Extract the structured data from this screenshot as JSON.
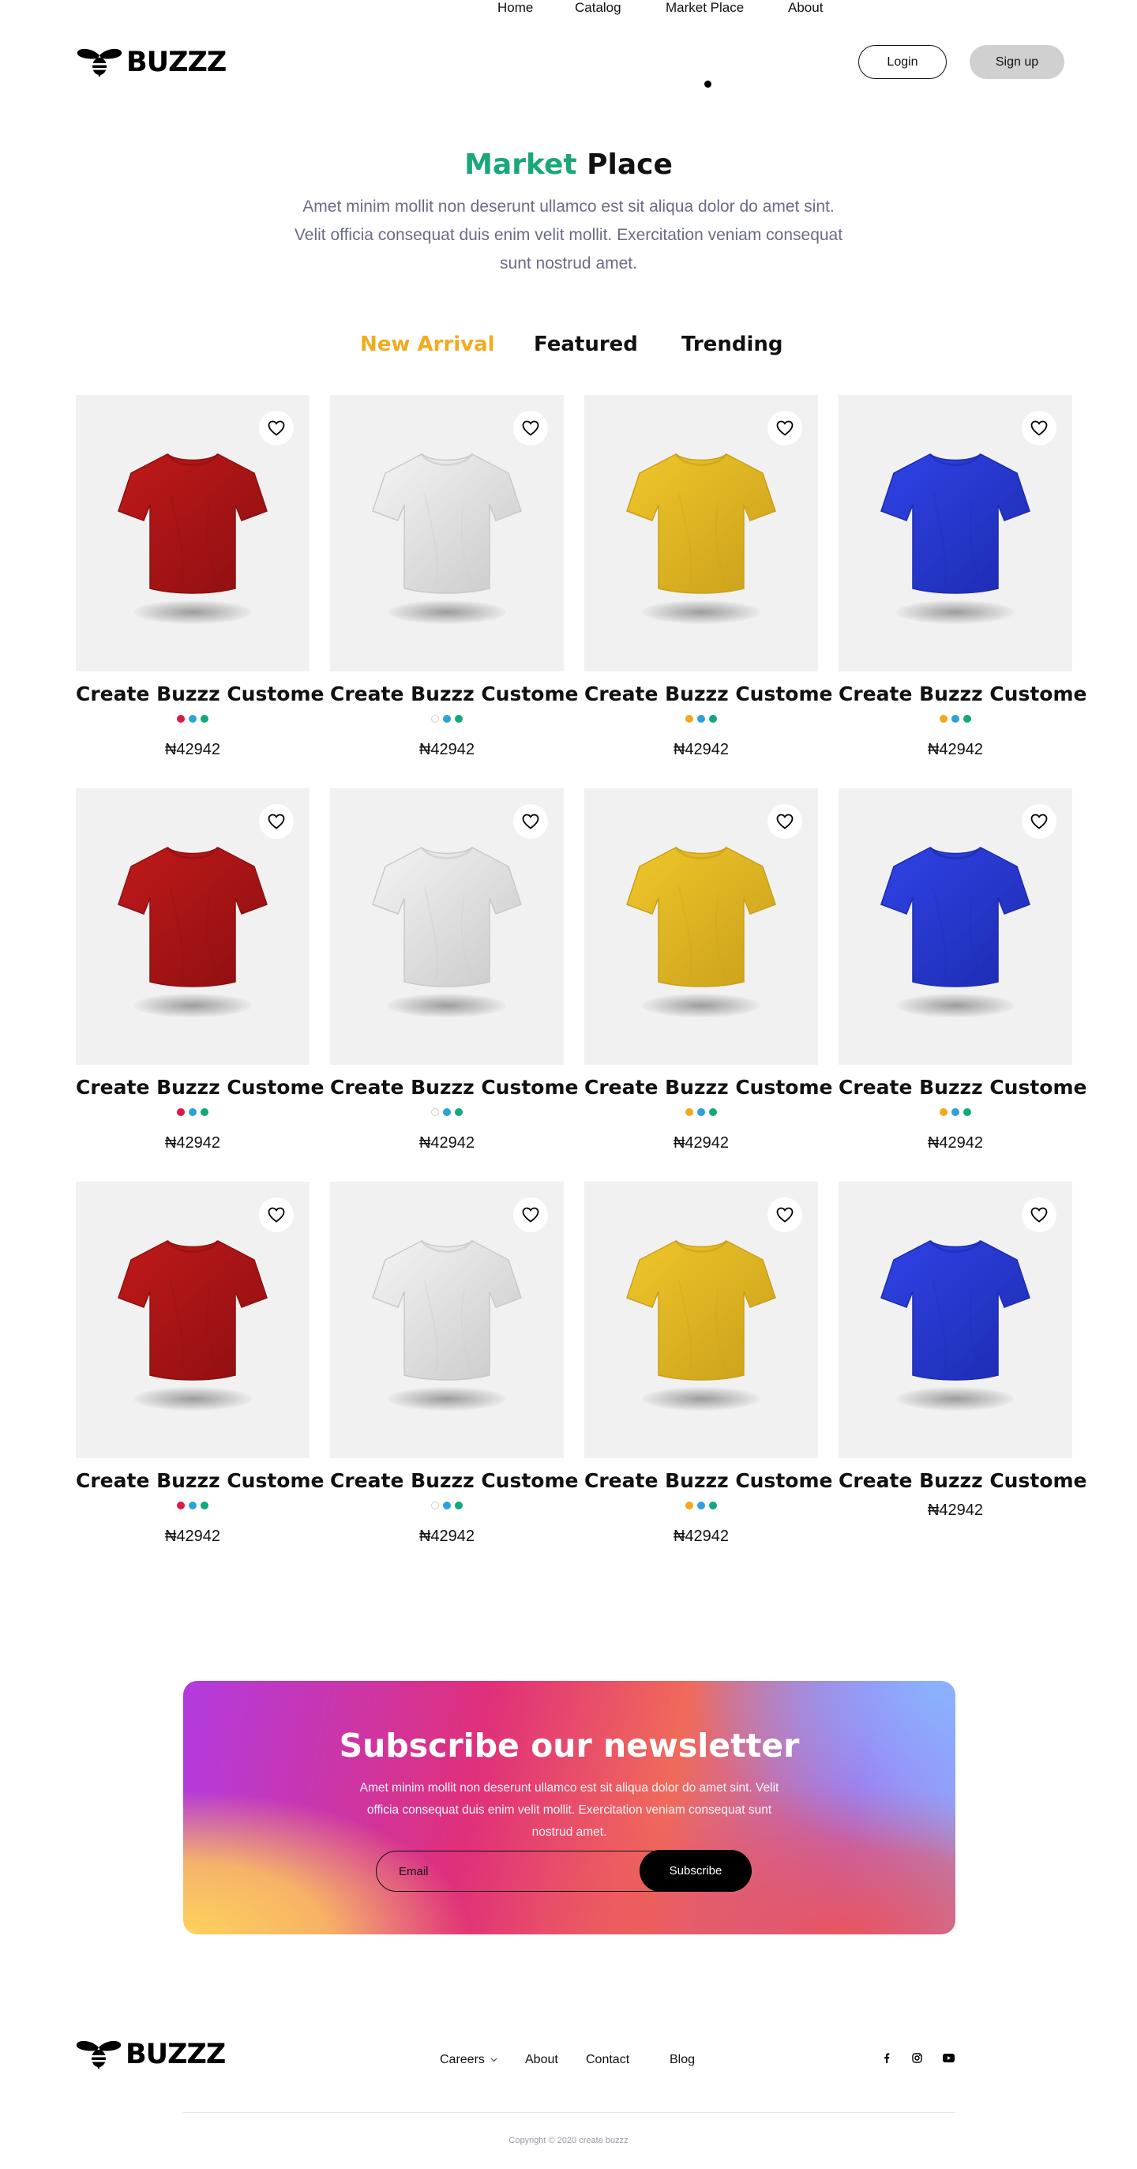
{
  "brand": {
    "name": "BUZZZ"
  },
  "nav": {
    "items": [
      {
        "label": "Home"
      },
      {
        "label": "Catalog"
      },
      {
        "label": "Market Place",
        "active": true
      },
      {
        "label": "About"
      }
    ],
    "login": "Login",
    "signup": "Sign up"
  },
  "hero": {
    "title_accent": "Market",
    "title_rest": "Place",
    "description": "Amet minim mollit non deserunt ullamco est sit aliqua dolor do amet sint. Velit officia consequat duis enim velit mollit. Exercitation veniam consequat sunt nostrud amet."
  },
  "tabs": [
    {
      "label": "New Arrival",
      "active": true
    },
    {
      "label": "Featured"
    },
    {
      "label": "Trending"
    }
  ],
  "colors": {
    "accent_green": "#1aa67a",
    "accent_orange": "#f2ab1f",
    "shirt_red": "#c0191a",
    "shirt_white": "#f4f4f4",
    "shirt_yellow": "#efc629",
    "shirt_blue": "#2f43e6"
  },
  "products": [
    {
      "title": "Create Buzzz Custome",
      "price": "₦42942",
      "shirt_color": "red",
      "swatches": [
        "#e0174b",
        "#2ea1d8",
        "#0fa97c"
      ]
    },
    {
      "title": "Create Buzzz Custome",
      "price": "₦42942",
      "shirt_color": "white",
      "swatches": [
        "#ffffff",
        "#2ea1d8",
        "#0fa97c"
      ]
    },
    {
      "title": "Create Buzzz Custome",
      "price": "₦42942",
      "shirt_color": "yellow",
      "swatches": [
        "#f2a81d",
        "#2ea1d8",
        "#0fa97c"
      ]
    },
    {
      "title": "Create Buzzz Custome",
      "price": "₦42942",
      "shirt_color": "blue",
      "swatches": [
        "#f2a81d",
        "#2ea1d8",
        "#0fa97c"
      ]
    },
    {
      "title": "Create Buzzz Custome",
      "price": "₦42942",
      "shirt_color": "red",
      "swatches": [
        "#e0174b",
        "#2ea1d8",
        "#0fa97c"
      ]
    },
    {
      "title": "Create Buzzz Custome",
      "price": "₦42942",
      "shirt_color": "white",
      "swatches": [
        "#ffffff",
        "#2ea1d8",
        "#0fa97c"
      ]
    },
    {
      "title": "Create Buzzz Custome",
      "price": "₦42942",
      "shirt_color": "yellow",
      "swatches": [
        "#f2a81d",
        "#2ea1d8",
        "#0fa97c"
      ]
    },
    {
      "title": "Create Buzzz Custome",
      "price": "₦42942",
      "shirt_color": "blue",
      "swatches": [
        "#f2a81d",
        "#2ea1d8",
        "#0fa97c"
      ]
    },
    {
      "title": "Create Buzzz Custome",
      "price": "₦42942",
      "shirt_color": "red",
      "swatches": [
        "#e0174b",
        "#2ea1d8",
        "#0fa97c"
      ]
    },
    {
      "title": "Create Buzzz Custome",
      "price": "₦42942",
      "shirt_color": "white",
      "swatches": [
        "#ffffff",
        "#2ea1d8",
        "#0fa97c"
      ]
    },
    {
      "title": "Create Buzzz Custome",
      "price": "₦42942",
      "shirt_color": "yellow",
      "swatches": [
        "#f2a81d",
        "#2ea1d8",
        "#0fa97c"
      ]
    },
    {
      "title": "Create Buzzz Custome",
      "price": "₦42942",
      "shirt_color": "blue",
      "swatches": []
    }
  ],
  "newsletter": {
    "title": "Subscribe our newsletter",
    "description": "Amet minim mollit non deserunt ullamco est sit aliqua dolor do amet sint. Velit officia consequat duis enim velit mollit. Exercitation veniam consequat sunt nostrud amet.",
    "email_placeholder": "Email",
    "button": "Subscribe"
  },
  "footer": {
    "nav": [
      {
        "label": "Careers",
        "has_dropdown": true
      },
      {
        "label": "About"
      },
      {
        "label": "Contact"
      },
      {
        "label": "Blog"
      }
    ],
    "social": [
      {
        "icon": "facebook-icon"
      },
      {
        "icon": "instagram-icon"
      },
      {
        "icon": "youtube-icon"
      }
    ],
    "copyright": "Copyright © 2020 create buzzz"
  }
}
